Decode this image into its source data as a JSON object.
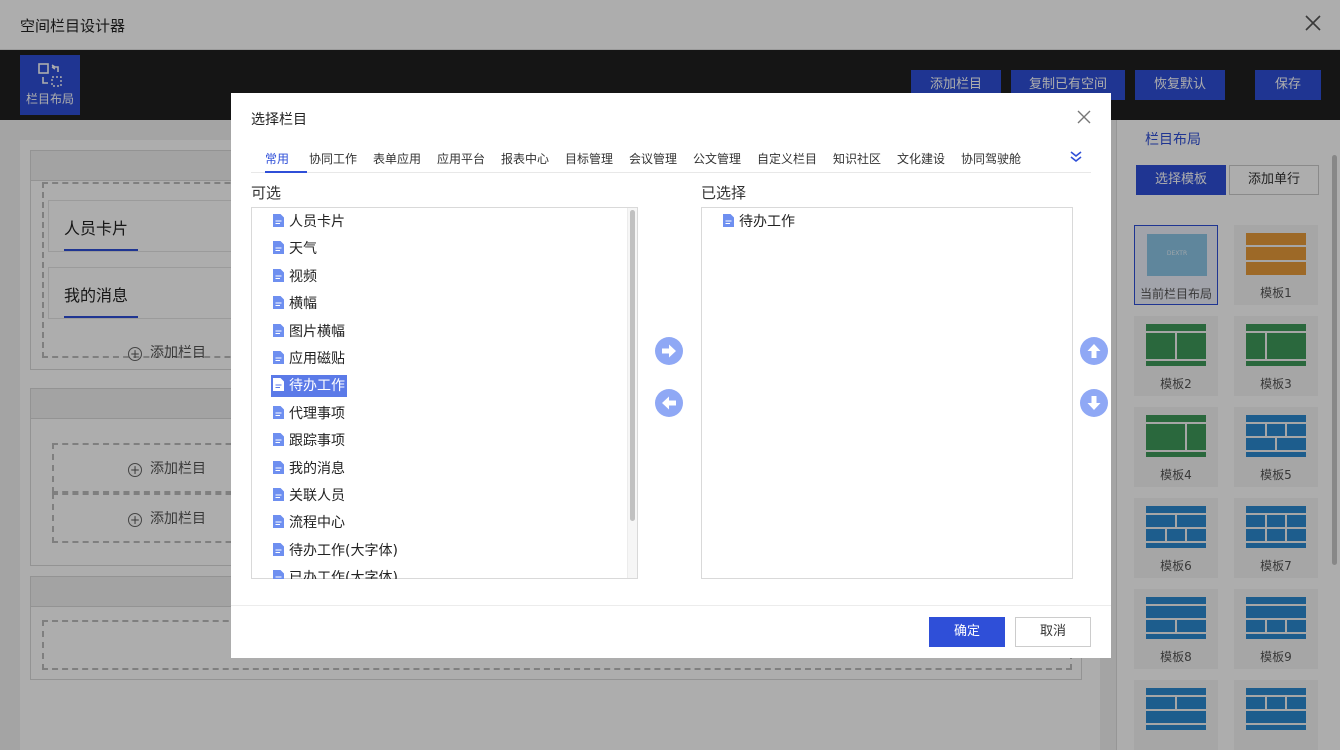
{
  "window": {
    "title": "空间栏目设计器"
  },
  "toolbar": {
    "layout_label": "栏目布局",
    "buttons": [
      "添加栏目",
      "复制已有空间",
      "恢复默认",
      "保存"
    ]
  },
  "canvas": {
    "cards": [
      "人员卡片",
      "我的消息"
    ],
    "add_column": "添加栏目"
  },
  "right_panel": {
    "title": "栏目布局",
    "select_template": "选择模板",
    "add_row": "添加单行",
    "templates": [
      "当前栏目布局",
      "模板1",
      "模板2",
      "模板3",
      "模板4",
      "模板5",
      "模板6",
      "模板7",
      "模板8",
      "模板9"
    ],
    "current_thumb_text": "DEXTR"
  },
  "modal": {
    "title": "选择栏目",
    "tabs": [
      "常用",
      "协同工作",
      "表单应用",
      "应用平台",
      "报表中心",
      "目标管理",
      "会议管理",
      "公文管理",
      "自定义栏目",
      "知识社区",
      "文化建设",
      "协同驾驶舱"
    ],
    "active_tab": "常用",
    "available_label": "可选",
    "selected_label": "已选择",
    "available": [
      "人员卡片",
      "天气",
      "视频",
      "横幅",
      "图片横幅",
      "应用磁贴",
      "待办工作",
      "代理事项",
      "跟踪事项",
      "我的消息",
      "关联人员",
      "流程中心",
      "待办工作(大字体)",
      "已办工作(大字体)"
    ],
    "highlighted": "待办工作",
    "selected": [
      "待办工作"
    ],
    "ok": "确定",
    "cancel": "取消"
  },
  "colors": {
    "accent": "#2f4fd8",
    "selection": "#5b7ae8",
    "arrow_circle": "#8fa8f5"
  }
}
